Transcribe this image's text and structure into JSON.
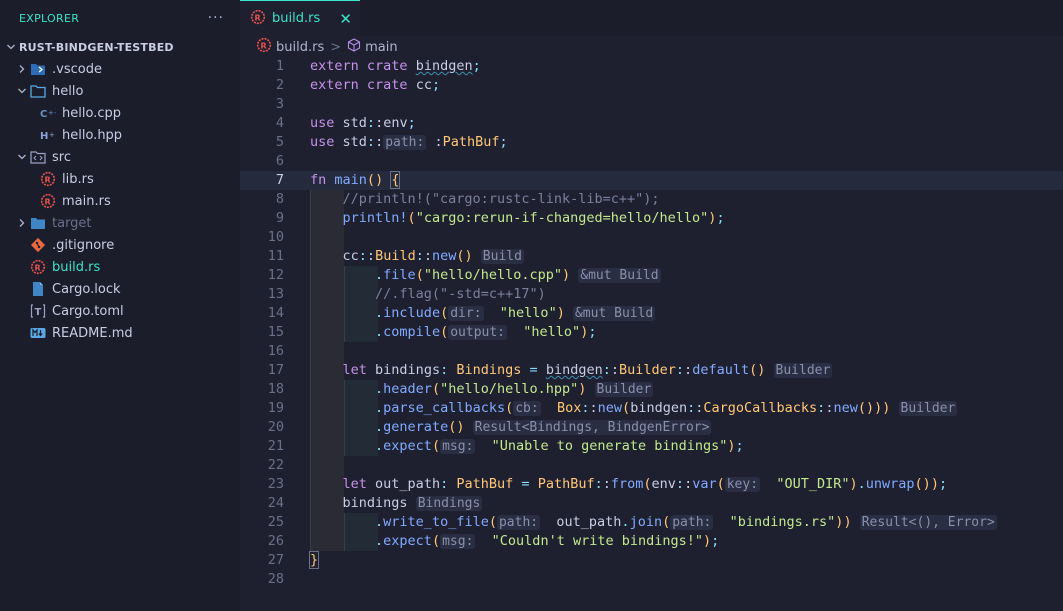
{
  "sidebar": {
    "title": "EXPLORER",
    "more": "···",
    "root": "RUST-BINDGEN-TESTBED",
    "items": [
      {
        "label": ".vscode",
        "icon": "vscode-folder-icon",
        "kind": "folder",
        "expanded": false,
        "depth": 1
      },
      {
        "label": "hello",
        "icon": "folder-icon",
        "kind": "folder",
        "expanded": true,
        "depth": 1
      },
      {
        "label": "hello.cpp",
        "icon": "cpp-file-icon",
        "kind": "file",
        "depth": 2
      },
      {
        "label": "hello.hpp",
        "icon": "hpp-file-icon",
        "kind": "file",
        "depth": 2
      },
      {
        "label": "src",
        "icon": "src-folder-icon",
        "kind": "folder",
        "expanded": true,
        "depth": 1
      },
      {
        "label": "lib.rs",
        "icon": "rust-file-icon",
        "kind": "file",
        "depth": 2
      },
      {
        "label": "main.rs",
        "icon": "rust-file-icon",
        "kind": "file",
        "depth": 2
      },
      {
        "label": "target",
        "icon": "folder-icon",
        "kind": "folder",
        "expanded": false,
        "depth": 1,
        "dim": true
      },
      {
        "label": ".gitignore",
        "icon": "git-icon",
        "kind": "file",
        "depth": 1
      },
      {
        "label": "build.rs",
        "icon": "rust-file-icon",
        "kind": "file",
        "depth": 1,
        "active": true
      },
      {
        "label": "Cargo.lock",
        "icon": "lock-file-icon",
        "kind": "file",
        "depth": 1
      },
      {
        "label": "Cargo.toml",
        "icon": "toml-file-icon",
        "kind": "file",
        "depth": 1
      },
      {
        "label": "README.md",
        "icon": "markdown-icon",
        "kind": "file",
        "depth": 1
      }
    ]
  },
  "tab": {
    "label": "build.rs",
    "close": "✕"
  },
  "breadcrumb": {
    "file": "build.rs",
    "sep": ">",
    "symbol": "main"
  },
  "editor": {
    "current_line": 7,
    "lines": [
      "extern crate bindgen;",
      "extern crate cc;",
      "",
      "use std::env;",
      "use std::path::PathBuf;",
      "",
      "fn main() {",
      "    //println!(\"cargo:rustc-link-lib=c++\");",
      "    println!(\"cargo:rerun-if-changed=hello/hello\");",
      "",
      "    cc::Build::new() Build",
      "        .file(\"hello/hello.cpp\") &mut Build",
      "        //.flag(\"-std=c++17\")",
      "        .include(dir: \"hello\") &mut Build",
      "        .compile(output: \"hello\");",
      "",
      "    let bindings: Bindings = bindgen::Builder::default() Builder",
      "        .header(\"hello/hello.hpp\") Builder",
      "        .parse_callbacks(cb: Box::new(bindgen::CargoCallbacks::new())) Builder",
      "        .generate() Result<Bindings, BindgenError>",
      "        .expect(msg: \"Unable to generate bindings\");",
      "",
      "    let out_path: PathBuf = PathBuf::from(env::var(key: \"OUT_DIR\").unwrap());",
      "    bindings Bindings",
      "        .write_to_file(path: out_path.join(path: \"bindings.rs\")) Result<(), Error>",
      "        .expect(msg: \"Couldn't write bindings!\");",
      "}",
      ""
    ]
  },
  "colors": {
    "accent": "#3be3c8",
    "background": "#1e2030",
    "sidebar": "#1b1d2b"
  }
}
